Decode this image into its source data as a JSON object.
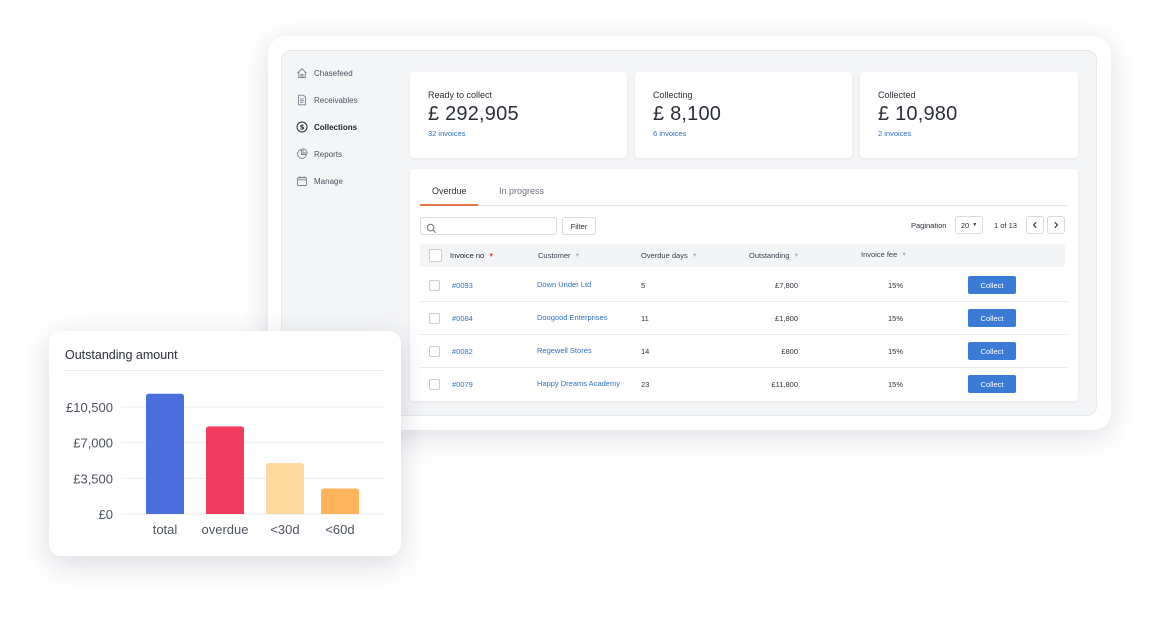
{
  "sidebar": {
    "items": [
      {
        "label": "Chasefeed",
        "icon": "home-icon"
      },
      {
        "label": "Receivables",
        "icon": "document-icon"
      },
      {
        "label": "Collections",
        "icon": "dollar-icon",
        "active": true
      },
      {
        "label": "Reports",
        "icon": "pie-chart-icon"
      },
      {
        "label": "Manage",
        "icon": "calendar-icon"
      }
    ]
  },
  "stats": [
    {
      "label": "Ready to collect",
      "amount": "£ 292,905",
      "sub": "32 invoices"
    },
    {
      "label": "Collecting",
      "amount": "£ 8,100",
      "sub": "6 invoices"
    },
    {
      "label": "Collected",
      "amount": "£ 10,980",
      "sub": "2 invoices"
    }
  ],
  "tabs": [
    {
      "label": "Overdue",
      "active": true
    },
    {
      "label": "In progress",
      "active": false
    }
  ],
  "toolbar": {
    "search_placeholder": "",
    "filter_label": "Filter",
    "pagination_label": "Pagination",
    "page_size": "20",
    "page_info": "1 of 13"
  },
  "table": {
    "columns": [
      "Invoice no",
      "Customer",
      "Overdue days",
      "Outstanding",
      "Invoice fee"
    ],
    "rows": [
      {
        "invoice": "#0093",
        "customer": "Down Under Ltd",
        "days": "5",
        "outstanding": "£7,800",
        "fee": "15%",
        "action": "Collect"
      },
      {
        "invoice": "#0084",
        "customer": "Doogood Enterprises",
        "days": "11",
        "outstanding": "£1,800",
        "fee": "15%",
        "action": "Collect"
      },
      {
        "invoice": "#0082",
        "customer": "Regewell Stores",
        "days": "14",
        "outstanding": "£800",
        "fee": "15%",
        "action": "Collect"
      },
      {
        "invoice": "#0079",
        "customer": "Happy Dreams Academy",
        "days": "23",
        "outstanding": "£11,800",
        "fee": "15%",
        "action": "Collect"
      }
    ]
  },
  "chart": {
    "title": "Outstanding amount"
  },
  "chart_data": {
    "type": "bar",
    "title": "Outstanding amount",
    "categories": [
      "total",
      "overdue",
      "<30d",
      "<60d"
    ],
    "values": [
      11800,
      8600,
      5000,
      2500
    ],
    "colors": [
      "#4a6fdc",
      "#f23c5f",
      "#ffd9a0",
      "#ffb45c"
    ],
    "yticks": [
      0,
      3500,
      7000,
      10500
    ],
    "ytick_labels": [
      "£0",
      "£3,500",
      "£7,000",
      "£10,500"
    ],
    "ylim": [
      0,
      10500
    ],
    "grid": true,
    "xlabel": "",
    "ylabel": ""
  }
}
